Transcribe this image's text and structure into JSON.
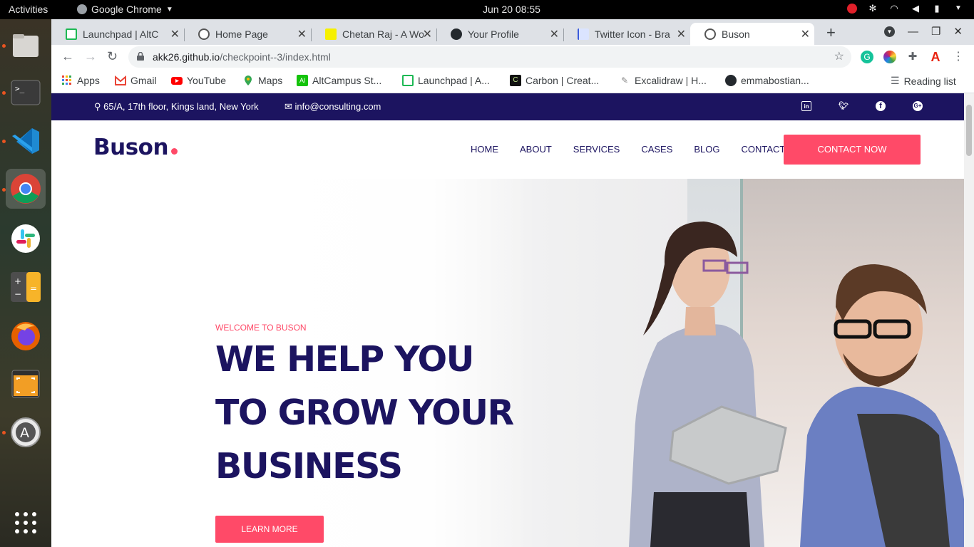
{
  "system": {
    "activities": "Activities",
    "app_menu": "Google Chrome",
    "clock": "Jun 20  08:55"
  },
  "browser": {
    "tabs": [
      {
        "title": "Launchpad | AltC",
        "icon": "altcampus-icon"
      },
      {
        "title": "Home Page",
        "icon": "globe-icon"
      },
      {
        "title": "Chetan Raj - A Wo",
        "icon": "yellow-square-icon"
      },
      {
        "title": "Your Profile",
        "icon": "github-icon"
      },
      {
        "title": "Twitter Icon - Bra",
        "icon": "flag-icon"
      },
      {
        "title": "Buson",
        "icon": "globe-icon"
      }
    ],
    "address": {
      "host": "akk26.github.io",
      "path": "/checkpoint--3/index.html"
    },
    "bookmarks": [
      {
        "label": "Apps",
        "icon": "apps-icon"
      },
      {
        "label": "Gmail",
        "icon": "gmail-icon"
      },
      {
        "label": "YouTube",
        "icon": "youtube-icon"
      },
      {
        "label": "Maps",
        "icon": "maps-icon"
      },
      {
        "label": "AltCampus St...",
        "icon": "altcampus-icon"
      },
      {
        "label": "Launchpad | A...",
        "icon": "launchpad-icon"
      },
      {
        "label": "Carbon | Creat...",
        "icon": "carbon-icon"
      },
      {
        "label": "Excalidraw | H...",
        "icon": "excalidraw-icon"
      },
      {
        "label": "emmabostian...",
        "icon": "github-icon"
      }
    ],
    "reading_list": "Reading list"
  },
  "site": {
    "address": "65/A, 17th floor, Kings land, New York",
    "email": "info@consulting.com",
    "logo": "Buson",
    "nav": [
      "HOME",
      "ABOUT",
      "SERVICES",
      "CASES",
      "BLOG",
      "CONTACT"
    ],
    "cta": "CONTACT NOW",
    "hero": {
      "welcome": "WELCOME TO BUSON",
      "line1": "WE HELP YOU",
      "line2": "TO GROW YOUR",
      "line3": "BUSINESS",
      "button": "LEARN MORE"
    }
  },
  "colors": {
    "brand_dark": "#1c1460",
    "accent": "#ff4a68"
  }
}
